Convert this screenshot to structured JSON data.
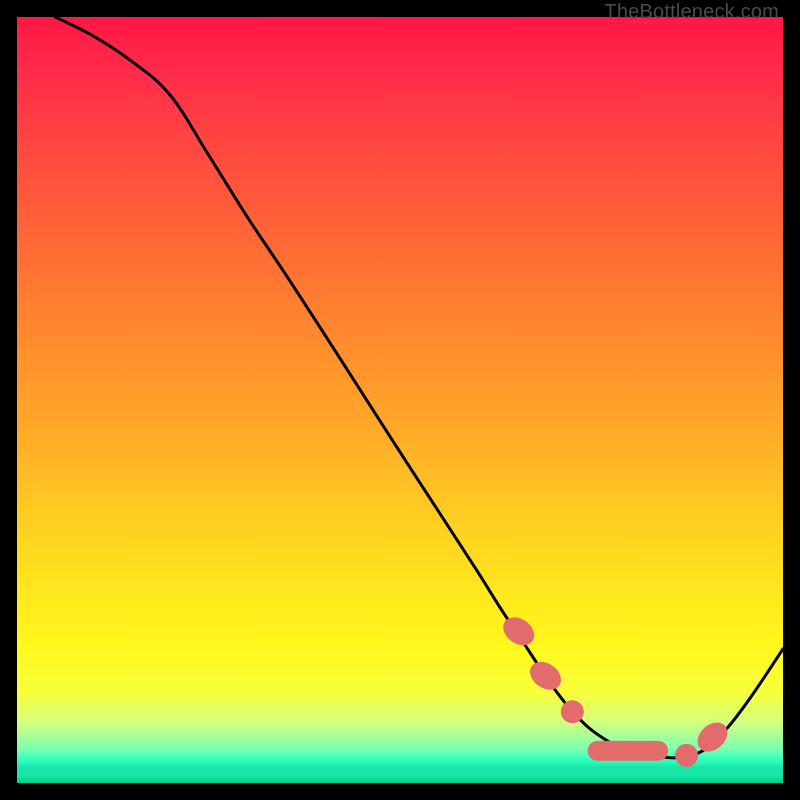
{
  "watermark": "TheBottleneck.com",
  "chart_data": {
    "type": "line",
    "title": "",
    "xlabel": "",
    "ylabel": "",
    "xlim": [
      0,
      100
    ],
    "ylim": [
      0,
      100
    ],
    "series": [
      {
        "name": "curve",
        "x": [
          5,
          10,
          15,
          20,
          25,
          30,
          35,
          40,
          45,
          50,
          55,
          60,
          63,
          66,
          70,
          73,
          76,
          80,
          84,
          87,
          90,
          93,
          96,
          100
        ],
        "values": [
          100,
          97.5,
          94.2,
          89.8,
          82,
          74,
          66.5,
          58.8,
          51,
          43.2,
          35.5,
          27.8,
          23,
          18.5,
          12.5,
          8.8,
          6.2,
          4.0,
          3.4,
          3.4,
          4.5,
          7.5,
          11.5,
          17.5
        ]
      }
    ],
    "markers": [
      {
        "shape": "ellipse",
        "x": 65.5,
        "y": 19.8,
        "rx": 1.6,
        "ry": 2.2,
        "angle": -55
      },
      {
        "shape": "ellipse",
        "x": 69.0,
        "y": 14.0,
        "rx": 1.6,
        "ry": 2.2,
        "angle": -55
      },
      {
        "shape": "ellipse",
        "x": 90.8,
        "y": 6.0,
        "rx": 1.6,
        "ry": 2.2,
        "angle": 48
      },
      {
        "shape": "round",
        "x": 72.5,
        "y": 9.3,
        "r": 1.5
      },
      {
        "shape": "round",
        "x": 87.4,
        "y": 3.6,
        "r": 1.5
      },
      {
        "shape": "capsule",
        "x1": 74.5,
        "x2": 85.0,
        "y": 4.2,
        "r": 1.3
      }
    ],
    "marker_color": "#e46b6b",
    "curve_color": "#000000"
  }
}
